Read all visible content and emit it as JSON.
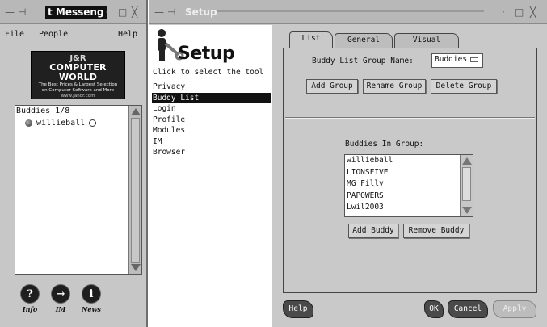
{
  "left_window": {
    "title": "t Messeng",
    "titlebar_controls": [
      "—",
      "⊣",
      "·",
      "□",
      "╳"
    ],
    "menu": {
      "file": "File",
      "people": "People",
      "help": "Help"
    },
    "ad": {
      "brand_top": "J&R",
      "brand_main": "COMPUTER WORLD",
      "tagline_1": "The Best Prices & Largest Selection",
      "tagline_2": "on Computer Software and More",
      "url": "www.jandr.com"
    },
    "buddy_list": {
      "header": "Buddies 1/8",
      "items": [
        {
          "name": "willieball"
        }
      ]
    },
    "toolbar": {
      "info": "Info",
      "im": "IM",
      "news": "News"
    }
  },
  "right_window": {
    "title": "Setup",
    "titlebar_controls": [
      "—",
      "⊣",
      "·",
      "□",
      "╳"
    ],
    "logo_text": "Setup",
    "hint": "Click to select the tool",
    "nav_items": [
      "Privacy",
      "Buddy List",
      "Login",
      "Profile",
      "Modules",
      "IM",
      "Browser"
    ],
    "selected_nav": "Buddy List",
    "tabs": [
      "List",
      "General",
      "Visual"
    ],
    "active_tab": "List",
    "group_name_label": "Buddy List Group Name:",
    "group_name_value": "Buddies",
    "group_buttons": {
      "add": "Add Group",
      "rename": "Rename Group",
      "delete": "Delete Group"
    },
    "buddies_label": "Buddies In Group:",
    "buddies": [
      "willieball",
      "LIONSFIVE",
      "MG Filly",
      "PAPOWERS",
      "Lwil2003"
    ],
    "buddy_buttons": {
      "add": "Add Buddy",
      "remove": "Remove Buddy"
    },
    "bottom_buttons": {
      "help": "Help",
      "ok": "OK",
      "cancel": "Cancel",
      "apply": "Apply"
    }
  }
}
